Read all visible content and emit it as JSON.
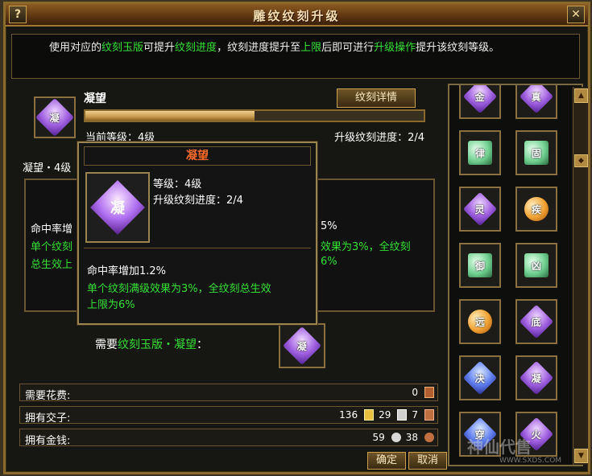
{
  "window": {
    "title": "雕纹纹刻升级",
    "help_label": "?",
    "close_label": "✕"
  },
  "description": {
    "part1": "使用对应的",
    "part2": "纹刻玉版",
    "part3": "可提升",
    "part4": "纹刻进度",
    "part5": "，纹刻进度提升至",
    "part6": "上限",
    "part7": "后即可进行",
    "part8": "升级操作",
    "part9": "提升该纹刻等级。"
  },
  "current": {
    "name": "凝望",
    "gem_char": "凝",
    "detail_button": "纹刻详情",
    "progress_fraction": 0.5,
    "level_text": "当前等级：4级",
    "progress_text": "升级纹刻进度：2/4",
    "effect_head": "凝望・4级",
    "effect_line1": "命中率增",
    "effect_line1_suffix": "5%",
    "effect_line2": "单个纹刻",
    "effect_line2_suffix": "效果为3%，全纹刻",
    "effect_line3": "总生效上",
    "effect_line3_suffix": "6%"
  },
  "tooltip": {
    "title": "凝望",
    "gem_char": "凝",
    "level": "等级：4级",
    "progress": "升级纹刻进度：2/4",
    "effect_white": "命中率增加1.2%",
    "effect_green1": "单个纹刻满级效果为3%，全纹刻总生效",
    "effect_green2": "上限为6%"
  },
  "requirement": {
    "prefix": "需要",
    "item": "纹刻玉版・凝望",
    "suffix": "：",
    "gem_char": "凝"
  },
  "stats": {
    "cost_label": "需要花费:",
    "cost_value": "0",
    "jiaozi_label": "拥有交子:",
    "jiaozi_gold": "136",
    "jiaozi_silver": "29",
    "jiaozi_copper": "7",
    "money_label": "拥有金钱:",
    "money_silver": "59",
    "money_copper": "38"
  },
  "buttons": {
    "confirm": "确定",
    "cancel": "取消"
  },
  "gem_list": [
    {
      "char": "金",
      "color": "purple"
    },
    {
      "char": "真",
      "color": "purple"
    },
    {
      "char": "律",
      "color": "green"
    },
    {
      "char": "固",
      "color": "green"
    },
    {
      "char": "灵",
      "color": "purple"
    },
    {
      "char": "疾",
      "color": "orange"
    },
    {
      "char": "御",
      "color": "green"
    },
    {
      "char": "凶",
      "color": "green"
    },
    {
      "char": "远",
      "color": "orange"
    },
    {
      "char": "底",
      "color": "purple"
    },
    {
      "char": "决",
      "color": "blue"
    },
    {
      "char": "凝",
      "color": "purple"
    },
    {
      "char": "穿",
      "color": "blue"
    },
    {
      "char": "火",
      "color": "purple"
    }
  ],
  "watermark": {
    "main": "神仙代售",
    "site": "WWW.SXDS.COM"
  },
  "colors": {
    "frame": "#8a6a2c",
    "accent_green": "#35e035",
    "tooltip_title": "#ff6a2a"
  }
}
